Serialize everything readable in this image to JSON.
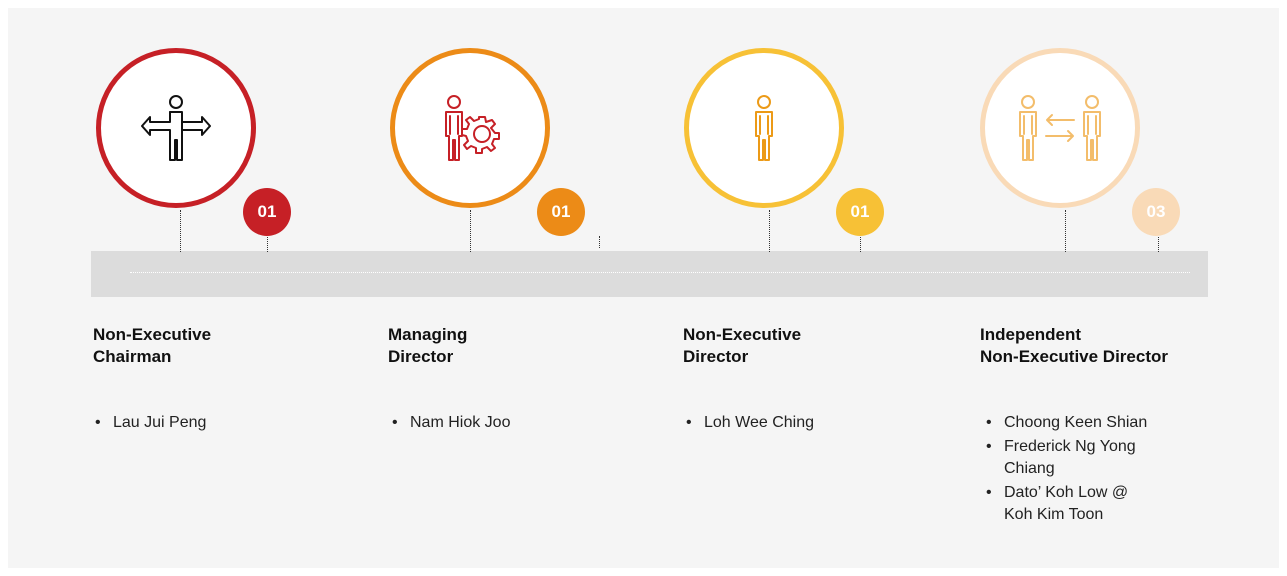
{
  "colors": {
    "panel": "#f5f5f5",
    "band": "#dcdcdc",
    "role1": "#c62026",
    "role2": "#ec8b17",
    "role3": "#f7c136",
    "role4": "#f9dab7"
  },
  "roles": [
    {
      "title_line1": "Non-Executive",
      "title_line2": "Chairman",
      "count": "01",
      "icon": "person-crossroads-arrows-icon",
      "members": [
        "Lau Jui Peng"
      ]
    },
    {
      "title_line1": "Managing",
      "title_line2": "Director",
      "count": "01",
      "icon": "person-gear-icon",
      "members": [
        "Nam Hiok Joo"
      ]
    },
    {
      "title_line1": "Non-Executive",
      "title_line2": "Director",
      "count": "01",
      "icon": "person-icon",
      "members": [
        "Loh Wee Ching"
      ]
    },
    {
      "title_line1": "Independent",
      "title_line2": "Non-Executive Director",
      "count": "03",
      "icon": "two-persons-exchange-icon",
      "members": [
        "Choong Keen Shian",
        "Frederick Ng Yong Chiang",
        "Dato’ Koh Low @ Koh Kim Toon"
      ]
    }
  ]
}
